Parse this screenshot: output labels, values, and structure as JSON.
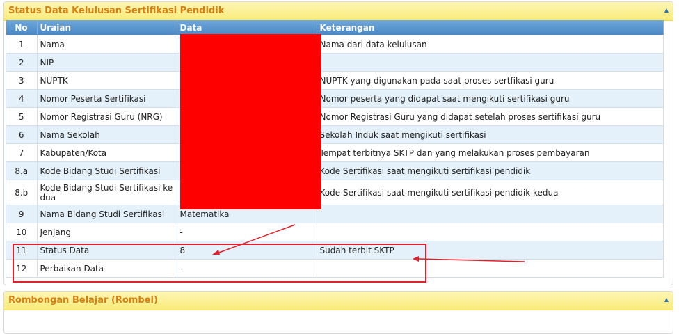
{
  "panel1": {
    "title": "Status Data Kelulusan Sertifikasi Pendidik",
    "headers": {
      "no": "No",
      "uraian": "Uraian",
      "data": "Data",
      "keterangan": "Keterangan"
    },
    "rows": [
      {
        "no": "1",
        "uraian": "Nama",
        "data": "",
        "keterangan": "Nama dari data kelulusan"
      },
      {
        "no": "2",
        "uraian": "NIP",
        "data": "",
        "keterangan": ""
      },
      {
        "no": "3",
        "uraian": "NUPTK",
        "data": "",
        "keterangan": "NUPTK yang digunakan pada saat proses sertfikasi guru"
      },
      {
        "no": "4",
        "uraian": "Nomor Peserta Sertifikasi",
        "data": "",
        "keterangan": "Nomor peserta yang didapat saat mengikuti sertifikasi guru"
      },
      {
        "no": "5",
        "uraian": "Nomor Registrasi Guru (NRG)",
        "data": "",
        "keterangan": "Nomor Registrasi Guru yang didapat setelah proses sertifikasi guru"
      },
      {
        "no": "6",
        "uraian": "Nama Sekolah",
        "data": "",
        "keterangan": "Sekolah Induk saat mengikuti sertifikasi"
      },
      {
        "no": "7",
        "uraian": "Kabupaten/Kota",
        "data": "",
        "keterangan": "Tempat terbitnya SKTP dan yang melakukan proses pembayaran"
      },
      {
        "no": "8.a",
        "uraian": "Kode Bidang Studi Sertifikasi",
        "data": "",
        "keterangan": "Kode Sertifikasi saat mengikuti sertifikasi pendidik"
      },
      {
        "no": "8.b",
        "uraian": "Kode Bidang Studi Sertifikasi ke dua",
        "data": "",
        "keterangan": "Kode Sertifikasi saat mengikuti sertifikasi pendidik kedua"
      },
      {
        "no": "9",
        "uraian": "Nama Bidang Studi Sertifikasi",
        "data": "Matematika",
        "keterangan": ""
      },
      {
        "no": "10",
        "uraian": "Jenjang",
        "data": "-",
        "keterangan": ""
      },
      {
        "no": "11",
        "uraian": "Status Data",
        "data": "8",
        "keterangan": "Sudah terbit SKTP"
      },
      {
        "no": "12",
        "uraian": "Perbaikan Data",
        "data": "-",
        "keterangan": ""
      }
    ]
  },
  "panel2": {
    "title": "Rombongan Belajar (Rombel)"
  },
  "colors": {
    "accent_title": "#d77f10",
    "header_blue": "#4b88c6",
    "redaction": "#ff0000",
    "annotation": "#e0202a"
  }
}
